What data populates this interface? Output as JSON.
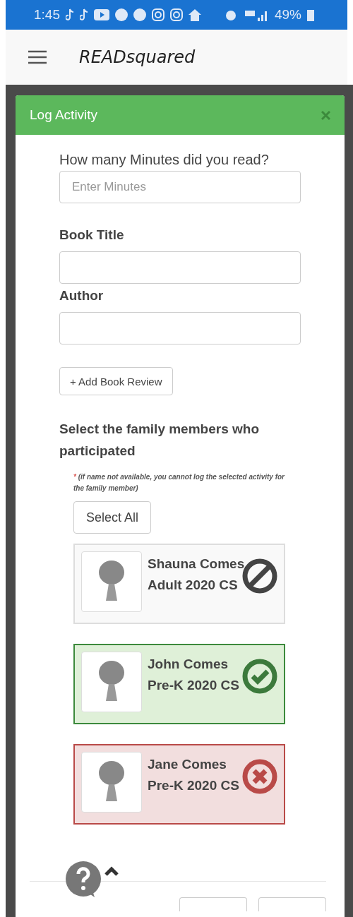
{
  "status_bar": {
    "time": "1:45",
    "battery": "49%"
  },
  "app_bar": {
    "title": "READsquared"
  },
  "modal": {
    "title": "Log Activity",
    "minutes": {
      "label": "How many Minutes did you read?",
      "placeholder": "Enter Minutes"
    },
    "book_title": {
      "label": "Book Title"
    },
    "author": {
      "label": "Author"
    },
    "review_button": "+ Add Book Review",
    "members_heading": "Select the family members who participated",
    "note": {
      "mark": "*",
      "text": "(if name not available, you cannot log the selected activity for the family member)"
    },
    "select_all": "Select All",
    "members": [
      {
        "name": "Shauna Comes",
        "program": "Adult 2020 CS",
        "available": false
      },
      {
        "name": "John Comes",
        "program": "Pre-K 2020 CS",
        "available": true,
        "selected": true
      },
      {
        "name": "Jane Comes",
        "program": "Pre-K 2020 CS",
        "available": true,
        "selected": false
      }
    ]
  }
}
